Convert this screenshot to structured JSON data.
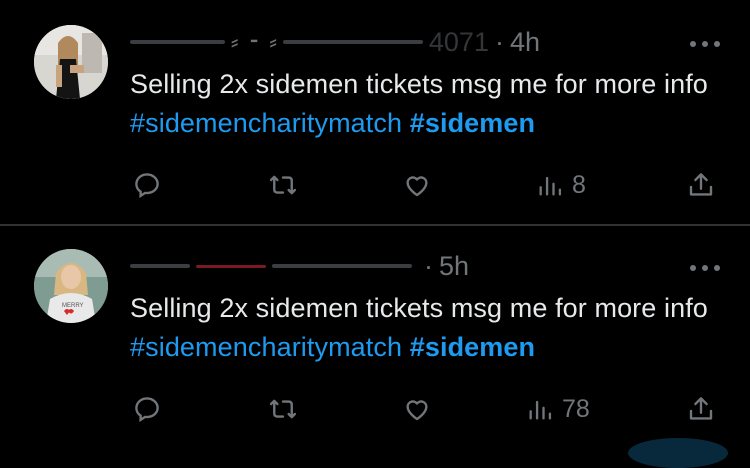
{
  "tweets": [
    {
      "name": "",
      "handle_suffix": "4071",
      "time": "4h",
      "text_prefix": "Selling 2x sidemen tickets msg me for more info",
      "hashtag1": "#sidemencharitymatch",
      "hashtag2": "#sidemen",
      "views": "8",
      "replies": "",
      "retweets": "",
      "likes": ""
    },
    {
      "name": "",
      "handle_suffix": "",
      "time": "5h",
      "text_prefix": "Selling 2x sidemen tickets msg me for more info",
      "hashtag1": "#sidemencharitymatch",
      "hashtag2": "#sidemen",
      "views": "78",
      "replies": "",
      "retweets": "",
      "likes": ""
    }
  ],
  "colors": {
    "background": "#000000",
    "text": "#e7e9ea",
    "muted": "#71767b",
    "link": "#1d9bf0",
    "divider": "#2f3336"
  },
  "icons": [
    "reply-icon",
    "retweet-icon",
    "like-icon",
    "views-icon",
    "share-icon",
    "more-icon"
  ]
}
